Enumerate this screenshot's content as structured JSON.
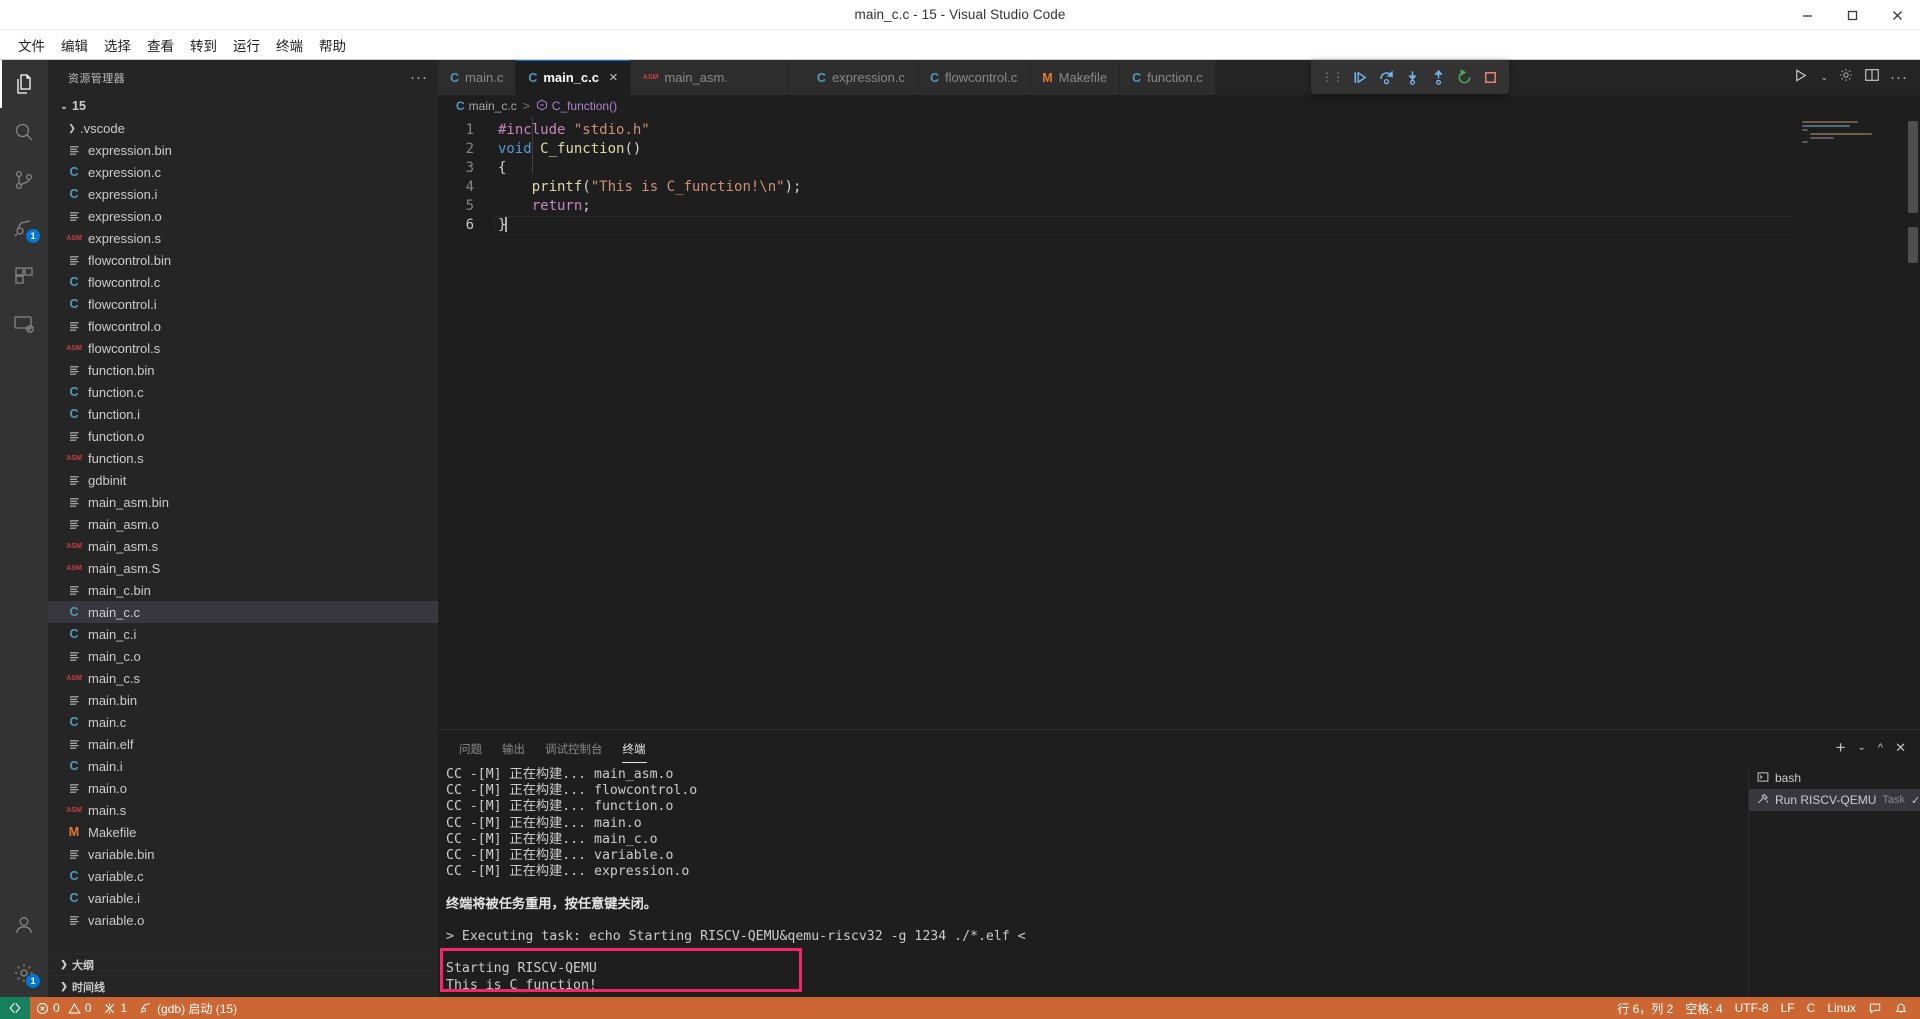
{
  "window": {
    "title": "main_c.c - 15 - Visual Studio Code",
    "minimize": "minimize-icon",
    "maximize": "maximize-icon",
    "close": "close-icon"
  },
  "menubar": {
    "items": [
      {
        "label": "文件"
      },
      {
        "label": "编辑"
      },
      {
        "label": "选择"
      },
      {
        "label": "查看"
      },
      {
        "label": "转到"
      },
      {
        "label": "运行"
      },
      {
        "label": "终端"
      },
      {
        "label": "帮助"
      }
    ]
  },
  "activitybar": {
    "items": [
      {
        "name": "explorer",
        "icon": "files-icon",
        "badge": ""
      },
      {
        "name": "search",
        "icon": "search-icon",
        "badge": ""
      },
      {
        "name": "source-control",
        "icon": "source-control-icon",
        "badge": ""
      },
      {
        "name": "run-and-debug",
        "icon": "debug-icon",
        "badge": "1"
      },
      {
        "name": "extensions",
        "icon": "extensions-icon",
        "badge": ""
      },
      {
        "name": "remote-explorer",
        "icon": "remote-explorer-icon",
        "badge": ""
      }
    ],
    "bottom": [
      {
        "name": "accounts",
        "icon": "account-icon",
        "badge": ""
      },
      {
        "name": "manage",
        "icon": "gear-icon",
        "badge": "1"
      }
    ]
  },
  "sidebar": {
    "title": "资源管理器",
    "more_actions": "···",
    "root": {
      "label": "15",
      "expanded": true
    },
    "files": [
      {
        "label": ".vscode",
        "icon": "folder",
        "folder": true
      },
      {
        "label": "expression.bin",
        "icon": "binary"
      },
      {
        "label": "expression.c",
        "icon": "c"
      },
      {
        "label": "expression.i",
        "icon": "c"
      },
      {
        "label": "expression.o",
        "icon": "binary"
      },
      {
        "label": "expression.s",
        "icon": "asm"
      },
      {
        "label": "flowcontrol.bin",
        "icon": "binary"
      },
      {
        "label": "flowcontrol.c",
        "icon": "c"
      },
      {
        "label": "flowcontrol.i",
        "icon": "c"
      },
      {
        "label": "flowcontrol.o",
        "icon": "binary"
      },
      {
        "label": "flowcontrol.s",
        "icon": "asm"
      },
      {
        "label": "function.bin",
        "icon": "binary"
      },
      {
        "label": "function.c",
        "icon": "c"
      },
      {
        "label": "function.i",
        "icon": "c"
      },
      {
        "label": "function.o",
        "icon": "binary"
      },
      {
        "label": "function.s",
        "icon": "asm"
      },
      {
        "label": "gdbinit",
        "icon": "binary"
      },
      {
        "label": "main_asm.bin",
        "icon": "binary"
      },
      {
        "label": "main_asm.o",
        "icon": "binary"
      },
      {
        "label": "main_asm.s",
        "icon": "asm"
      },
      {
        "label": "main_asm.S",
        "icon": "asm"
      },
      {
        "label": "main_c.bin",
        "icon": "binary"
      },
      {
        "label": "main_c.c",
        "icon": "c",
        "selected": true
      },
      {
        "label": "main_c.i",
        "icon": "c"
      },
      {
        "label": "main_c.o",
        "icon": "binary"
      },
      {
        "label": "main_c.s",
        "icon": "asm"
      },
      {
        "label": "main.bin",
        "icon": "binary"
      },
      {
        "label": "main.c",
        "icon": "c"
      },
      {
        "label": "main.elf",
        "icon": "binary"
      },
      {
        "label": "main.i",
        "icon": "c"
      },
      {
        "label": "main.o",
        "icon": "binary"
      },
      {
        "label": "main.s",
        "icon": "asm"
      },
      {
        "label": "Makefile",
        "icon": "makefile"
      },
      {
        "label": "variable.bin",
        "icon": "binary"
      },
      {
        "label": "variable.c",
        "icon": "c"
      },
      {
        "label": "variable.i",
        "icon": "c"
      },
      {
        "label": "variable.o",
        "icon": "binary"
      }
    ],
    "sections": [
      {
        "label": "大纲"
      },
      {
        "label": "时间线"
      }
    ]
  },
  "editor": {
    "tabs": [
      {
        "label": "main.c",
        "icon": "c",
        "active": false,
        "dirty": false
      },
      {
        "label": "main_c.c",
        "icon": "c",
        "active": true,
        "close": "×"
      },
      {
        "label": "main_asm.",
        "icon": "asm",
        "active": false
      },
      {
        "label": "expression.c",
        "icon": "c",
        "active": false
      },
      {
        "label": "flowcontrol.c",
        "icon": "c",
        "active": false
      },
      {
        "label": "Makefile",
        "icon": "makefile",
        "active": false
      },
      {
        "label": "function.c",
        "icon": "c",
        "active": false
      }
    ],
    "tab_actions": [
      {
        "name": "run-or-debug-icon",
        "label": "▷"
      },
      {
        "name": "split-editor-icon",
        "label": "▤"
      },
      {
        "name": "more-actions-icon",
        "label": "···"
      }
    ],
    "breadcrumb": {
      "file_icon": "c",
      "file": "main_c.c",
      "separator": ">",
      "symbol_icon": "symbol-function-icon",
      "symbol": "C_function()"
    },
    "debug_toolbar": {
      "buttons": [
        {
          "name": "debug-grip",
          "label": "⠿"
        },
        {
          "name": "debug-continue-icon",
          "label": "continue"
        },
        {
          "name": "debug-step-over-icon",
          "label": "step-over"
        },
        {
          "name": "debug-step-into-icon",
          "label": "step-into"
        },
        {
          "name": "debug-step-out-icon",
          "label": "step-out"
        },
        {
          "name": "debug-restart-icon",
          "label": "restart"
        },
        {
          "name": "debug-stop-icon",
          "label": "stop"
        }
      ]
    },
    "lines": [
      {
        "n": "1",
        "tokens": [
          {
            "t": "#include ",
            "c": "pre"
          },
          {
            "t": "\"stdio.h\"",
            "c": "str"
          }
        ]
      },
      {
        "n": "2",
        "tokens": [
          {
            "t": "void ",
            "c": "kw"
          },
          {
            "t": "C_function",
            "c": "fn"
          },
          {
            "t": "()",
            "c": "pl"
          }
        ]
      },
      {
        "n": "3",
        "tokens": [
          {
            "t": "{",
            "c": "pl"
          }
        ]
      },
      {
        "n": "4",
        "tokens": [
          {
            "t": "    ",
            "c": "pl"
          },
          {
            "t": "printf",
            "c": "fn"
          },
          {
            "t": "(",
            "c": "pl"
          },
          {
            "t": "\"This is C_function!\\n\"",
            "c": "str"
          },
          {
            "t": ");",
            "c": "pl"
          }
        ]
      },
      {
        "n": "5",
        "tokens": [
          {
            "t": "    ",
            "c": "pl"
          },
          {
            "t": "return",
            "c": "ctl"
          },
          {
            "t": ";",
            "c": "pl"
          }
        ]
      },
      {
        "n": "6",
        "tokens": [
          {
            "t": "}",
            "c": "pl"
          }
        ],
        "current": true,
        "cursor": true
      }
    ]
  },
  "panel": {
    "tabs": [
      {
        "label": "问题",
        "active": false
      },
      {
        "label": "输出",
        "active": false
      },
      {
        "label": "调试控制台",
        "active": false
      },
      {
        "label": "终端",
        "active": true
      }
    ],
    "actions": [
      {
        "name": "new-terminal-icon",
        "label": "+"
      },
      {
        "name": "terminal-dropdown-icon",
        "label": "⌄"
      },
      {
        "name": "maximize-panel-icon",
        "label": "^"
      },
      {
        "name": "close-panel-icon",
        "label": "✕"
      }
    ],
    "terminal_lines": [
      {
        "text": "CC -[M] 正在构建... main_asm.o"
      },
      {
        "text": "CC -[M] 正在构建... flowcontrol.o"
      },
      {
        "text": "CC -[M] 正在构建... function.o"
      },
      {
        "text": "CC -[M] 正在构建... main.o"
      },
      {
        "text": "CC -[M] 正在构建... main_c.o"
      },
      {
        "text": "CC -[M] 正在构建... variable.o"
      },
      {
        "text": "CC -[M] 正在构建... expression.o"
      },
      {
        "text": "",
        "blank": true
      },
      {
        "text": "终端将被任务重用，按任意键关闭。",
        "bold": true
      },
      {
        "text": "",
        "blank": true
      },
      {
        "text": "> Executing task: echo Starting RISCV-QEMU&qemu-riscv32 -g 1234 ./*.elf <"
      },
      {
        "text": "",
        "blank": true
      },
      {
        "text": "Starting RISCV-QEMU"
      },
      {
        "text": "This is C_function!"
      }
    ],
    "highlight_color": "#f5256b",
    "terminal_list": [
      {
        "label": "bash",
        "icon": "terminal-icon",
        "active": false,
        "kind": "",
        "check": ""
      },
      {
        "label": "Run RISCV-QEMU",
        "icon": "tools-icon",
        "active": true,
        "kind": "Task",
        "check": "✓"
      }
    ]
  },
  "statusbar": {
    "background": "#cc6633",
    "remote_icon": "remote-host-icon",
    "left": [
      {
        "name": "problems",
        "icon": "error-warning",
        "errors": "0",
        "warnings": "0"
      },
      {
        "name": "ports",
        "icon": "ports-icon",
        "label": "1"
      },
      {
        "name": "debug-launch",
        "icon": "debug-alt-icon",
        "label": "(gdb) 启动 (15)"
      }
    ],
    "right": [
      {
        "name": "cursor-position",
        "label": "行 6，列 2"
      },
      {
        "name": "indentation",
        "label": "空格: 4"
      },
      {
        "name": "encoding",
        "label": "UTF-8"
      },
      {
        "name": "eol",
        "label": "LF"
      },
      {
        "name": "language-mode",
        "label": "C"
      },
      {
        "name": "platform",
        "label": "Linux"
      },
      {
        "name": "feedback-icon",
        "label": ""
      },
      {
        "name": "notifications-icon",
        "label": ""
      }
    ]
  }
}
